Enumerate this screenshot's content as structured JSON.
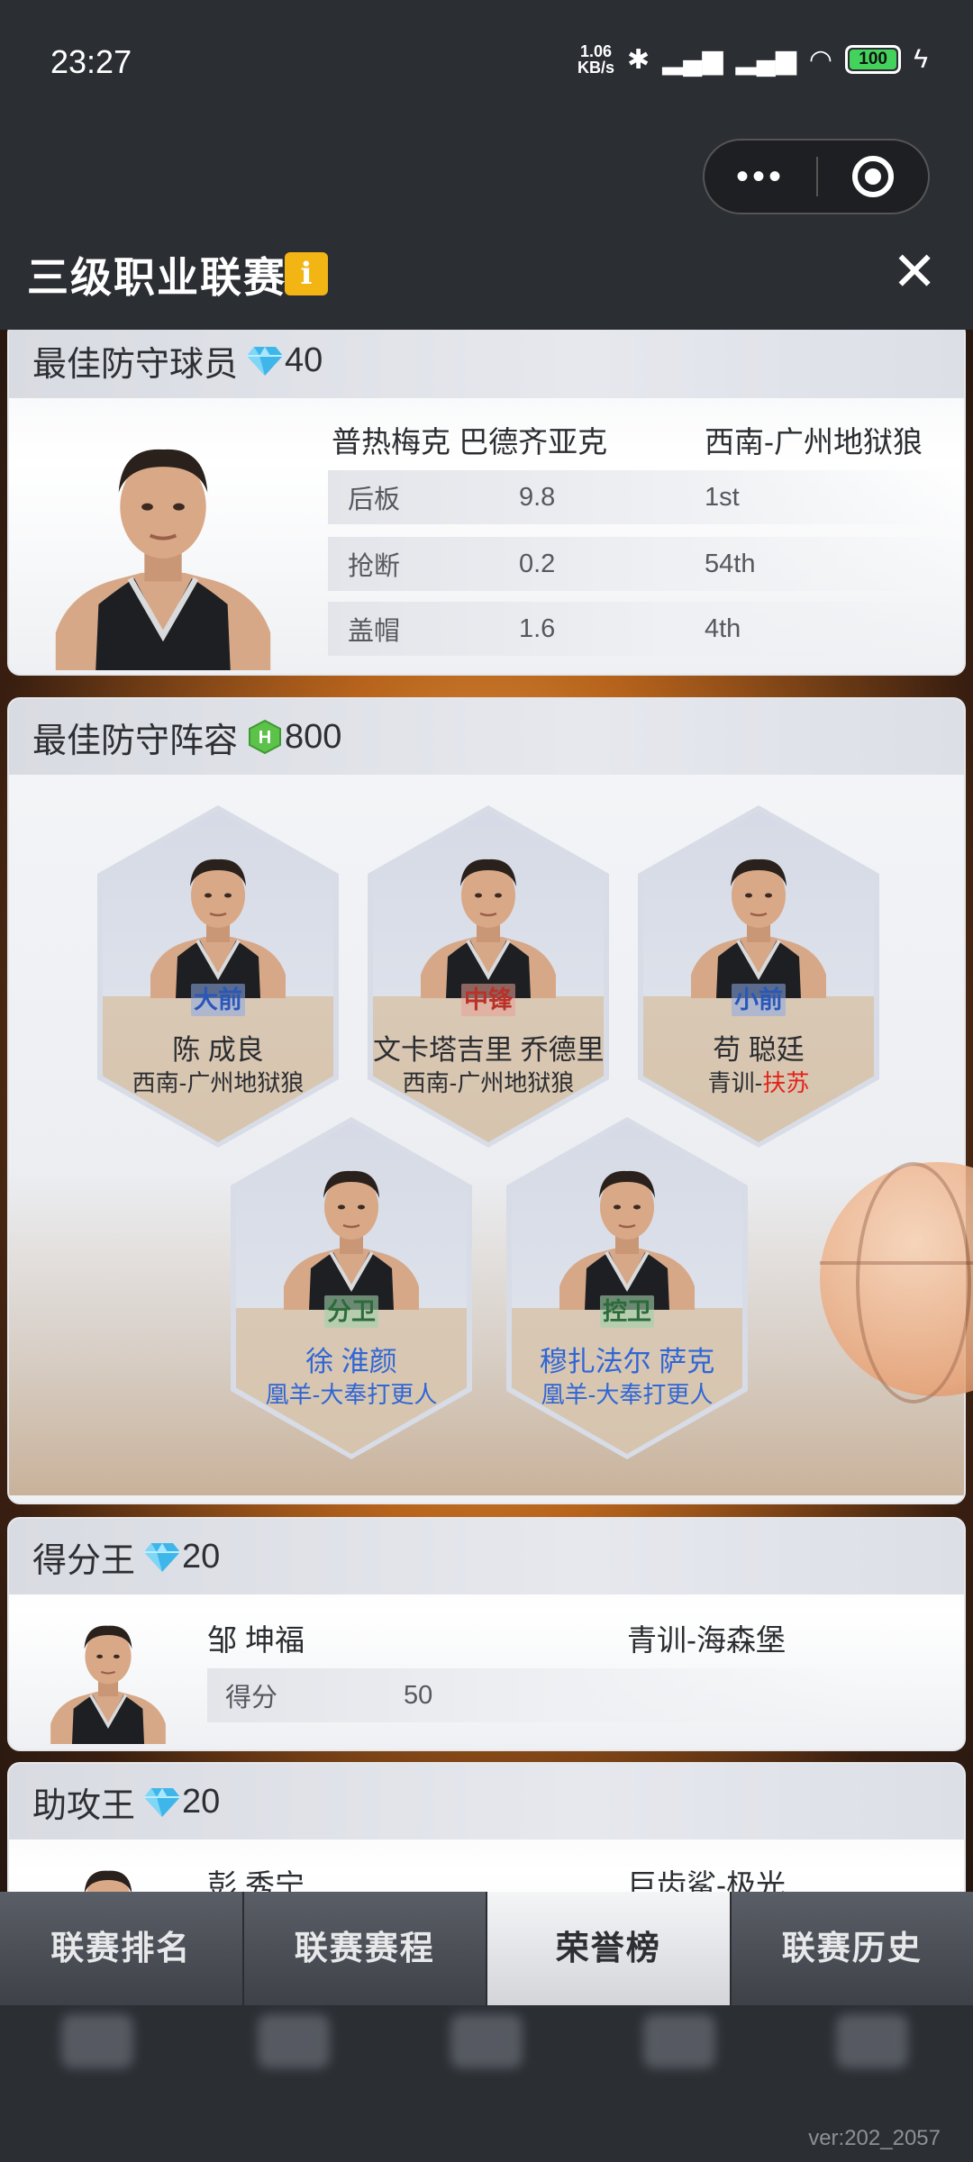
{
  "status_bar": {
    "time": "23:27",
    "net_speed_value": "1.06",
    "net_speed_unit": "KB/s",
    "battery": "100"
  },
  "header": {
    "title": "三级职业联赛",
    "info_icon": "i"
  },
  "best_defender": {
    "title": "最佳防守球员",
    "reward": "40",
    "player_name": "普热梅克 巴德齐亚克",
    "team": "西南-广州地狱狼",
    "stats": [
      {
        "label": "后板",
        "value": "9.8",
        "rank": "1st"
      },
      {
        "label": "抢断",
        "value": "0.2",
        "rank": "54th"
      },
      {
        "label": "盖帽",
        "value": "1.6",
        "rank": "4th"
      }
    ]
  },
  "best_defense_lineup": {
    "title": "最佳防守阵容",
    "reward": "800",
    "players": [
      {
        "position": "大前",
        "name": "陈 成良",
        "team": "西南-广州地狱狼"
      },
      {
        "position": "中锋",
        "name": "文卡塔吉里 乔德里",
        "team": "西南-广州地狱狼"
      },
      {
        "position": "小前",
        "name": "苟 聪廷",
        "team_prefix": "青训-",
        "team_suffix": "扶苏"
      },
      {
        "position": "分卫",
        "name": "徐 淮颜",
        "team": "凰羊-大奉打更人"
      },
      {
        "position": "控卫",
        "name": "穆扎法尔 萨克",
        "team": "凰羊-大奉打更人"
      }
    ]
  },
  "scoring_champion": {
    "title": "得分王",
    "reward": "20",
    "player_name": "邹 坤福",
    "team": "青训-海森堡",
    "stat_label": "得分",
    "stat_value": "50"
  },
  "assist_champion": {
    "title": "助攻王",
    "reward": "20",
    "player_name": "彭 秀宁",
    "team": "巨齿鲨-极光"
  },
  "tabs": [
    {
      "label": "联赛排名"
    },
    {
      "label": "联赛赛程"
    },
    {
      "label": "荣誉榜"
    },
    {
      "label": "联赛历史"
    }
  ],
  "version": "ver:202_2057",
  "colors": {
    "accent_gold": "#f2b514",
    "team_blue": "#2f66d6",
    "team_red": "#e2241b"
  }
}
